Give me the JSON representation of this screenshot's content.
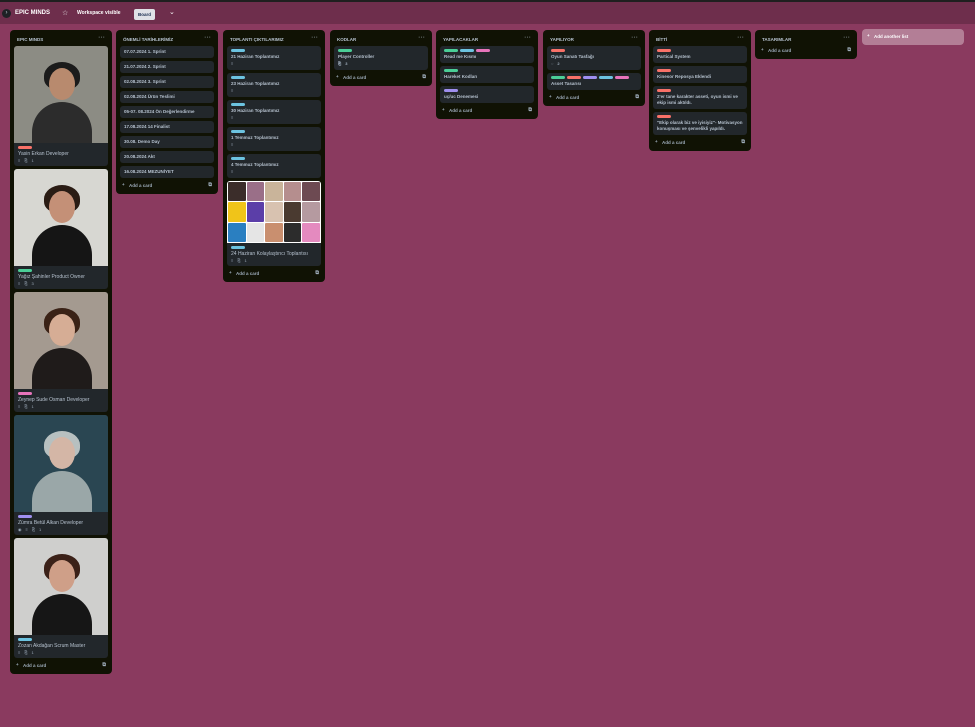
{
  "header": {
    "collapse_glyph": "›",
    "board_title": "EPIC MINDS",
    "star_glyph": "☆",
    "visibility": "Workspace visible",
    "view_label": "Board",
    "chevron_glyph": "⌄"
  },
  "common": {
    "list_menu": "···",
    "add_card": "Add a card",
    "plus": "+",
    "template_glyph": "⧉"
  },
  "colors": {
    "board_bg": "#8a3a5f",
    "list_bg": "#101204",
    "card_bg": "#22272b",
    "label_green": "#4bce97",
    "label_blue": "#6cc3e0",
    "label_purple": "#9f8fef",
    "label_pink": "#e774bb",
    "label_red": "#f87168"
  },
  "lists": {
    "epic_minds": {
      "title": "EPIC MINDS",
      "cards": [
        {
          "title": "Yasin Erkan Developer",
          "meta": "1"
        },
        {
          "title": "Yağız Şahinler Product Owner",
          "meta": "3"
        },
        {
          "title": "Zeynep Sude Osman Developer",
          "meta": "1"
        },
        {
          "title": "Zümra Betül Alkan Developer",
          "meta": "1"
        },
        {
          "title": "Zozan Akdağan Scrum Master",
          "meta": "1"
        }
      ]
    },
    "onemli": {
      "title": "ÖNEMLİ TARİHLERİMİZ",
      "cards": [
        "07.07.2024 1. Sprint",
        "21.07.2024 2. Sprint",
        "02.08.2024 3. Sprint",
        "02.08.2024 Ürün Teslimi",
        "05-07. 08.2024 Ön Değerlendirme",
        "17.08.2024 14 Finalist",
        "30.08. Demo Day",
        "20.08.2024 Akt",
        "16.08.2024 MEZUNİYET"
      ]
    },
    "toplanti": {
      "title": "TOPLANTI ÇIKTILARIMIZ",
      "cards": [
        "21 Haziran Toplantımız",
        "23 Haziran Toplantımız",
        "30 Haziran Toplantımız",
        "1 Temmuz Toplantımız",
        "4 Temmuz Toplantımız",
        "24 Haziran Kolaylaştırıcı Toplantısı"
      ],
      "cover_meta": "1"
    },
    "kodlar": {
      "title": "KODLAR",
      "cards": [
        "Player Controller"
      ],
      "meta": "3"
    },
    "yapilacaklar": {
      "title": "YAPILACAKLAR",
      "cards": [
        "Read me Kısmı",
        "Hareket Kodları",
        "uç/uc Denemesi"
      ]
    },
    "yapiliyor": {
      "title": "YAPILIYOR",
      "cards": [
        "Oyun Sanatı Tasfağı",
        "Asset Tasarısı"
      ],
      "meta": "2"
    },
    "bitti": {
      "title": "BİTTİ",
      "cards": [
        "Partical System",
        "Kinesor Reposya Eklendi",
        "2'er tane karakter asseti, oyun ismi ve ekip ismi aktıldı.",
        "\"Ekip olarak biz ve iyisiyiz\"- Motivasyon konuşması ve şenvelikli yapıldı."
      ]
    },
    "tasarimlar": {
      "title": "TASARIMLAR"
    }
  },
  "add_list": "Add another list"
}
